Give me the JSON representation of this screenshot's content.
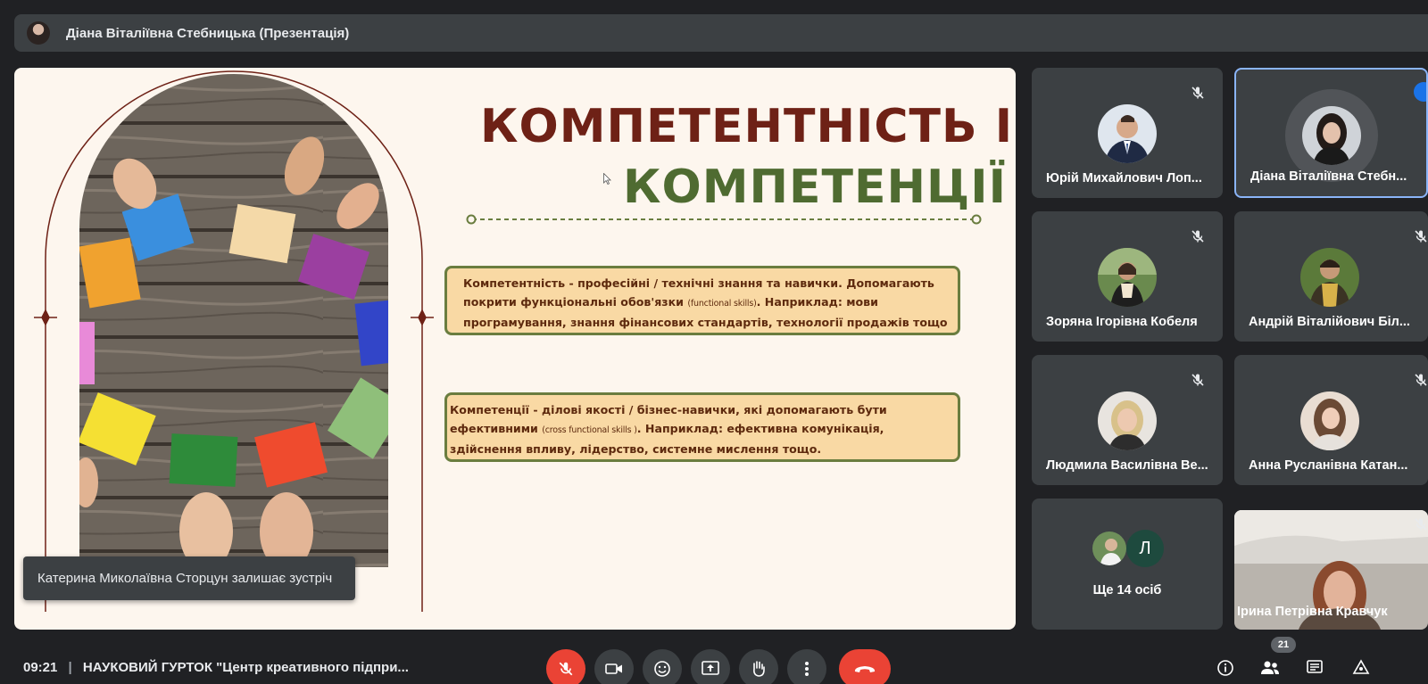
{
  "presenter_bar": {
    "title": "Діана Віталіївна Стебницька (Презентація)"
  },
  "slide": {
    "title_line1": "КОМПЕТЕНТНІСТЬ І",
    "title_line2": "КОМПЕТЕНЦІЇ",
    "box1": {
      "part1": "Компетентність - професійні / технічні знання та навички. Допомагають покрити функціональні обов'язки",
      "small": "(functional skills)",
      "part2": ". Наприклад: мови програмування, знання фінансових стандартів, технології продажів тощо"
    },
    "box2": {
      "part1": "Компетенції - ділові якості / бізнес-навички, які допомагають бути ефективними",
      "small": "(cross functional skills )",
      "part2": ". Наприклад: ефективна комунікація, здійснення впливу, лідерство, системне мислення тощо."
    }
  },
  "toast": {
    "text": "Катерина Миколаївна Сторцун залишає зустріч"
  },
  "participants": [
    {
      "name": "Юрій Михайлович Лоп...",
      "muted": true
    },
    {
      "name": "Діана Віталіївна Стебн...",
      "speaking": true
    },
    {
      "name": "Зоряна Ігорівна Кобеля",
      "muted": true
    },
    {
      "name": "Андрій Віталійович Біл...",
      "muted": true
    },
    {
      "name": "Людмила Василівна Ве...",
      "muted": true
    },
    {
      "name": "Анна Русланівна Катан...",
      "muted": true
    },
    {
      "name": "Ще 14 осіб",
      "initial": "Л"
    },
    {
      "name": "Ірина Петрівна Кравчук",
      "muted": true
    }
  ],
  "bottom_bar": {
    "time": "09:21",
    "separator": "|",
    "meeting_title": "НАУКОВИЙ ГУРТОК \"Центр креативного підпри...",
    "participants_count": "21"
  },
  "colors": {
    "accent_red": "#ea4335",
    "tile_bg": "#3c4043",
    "speaking_border": "#8ab4f8"
  }
}
